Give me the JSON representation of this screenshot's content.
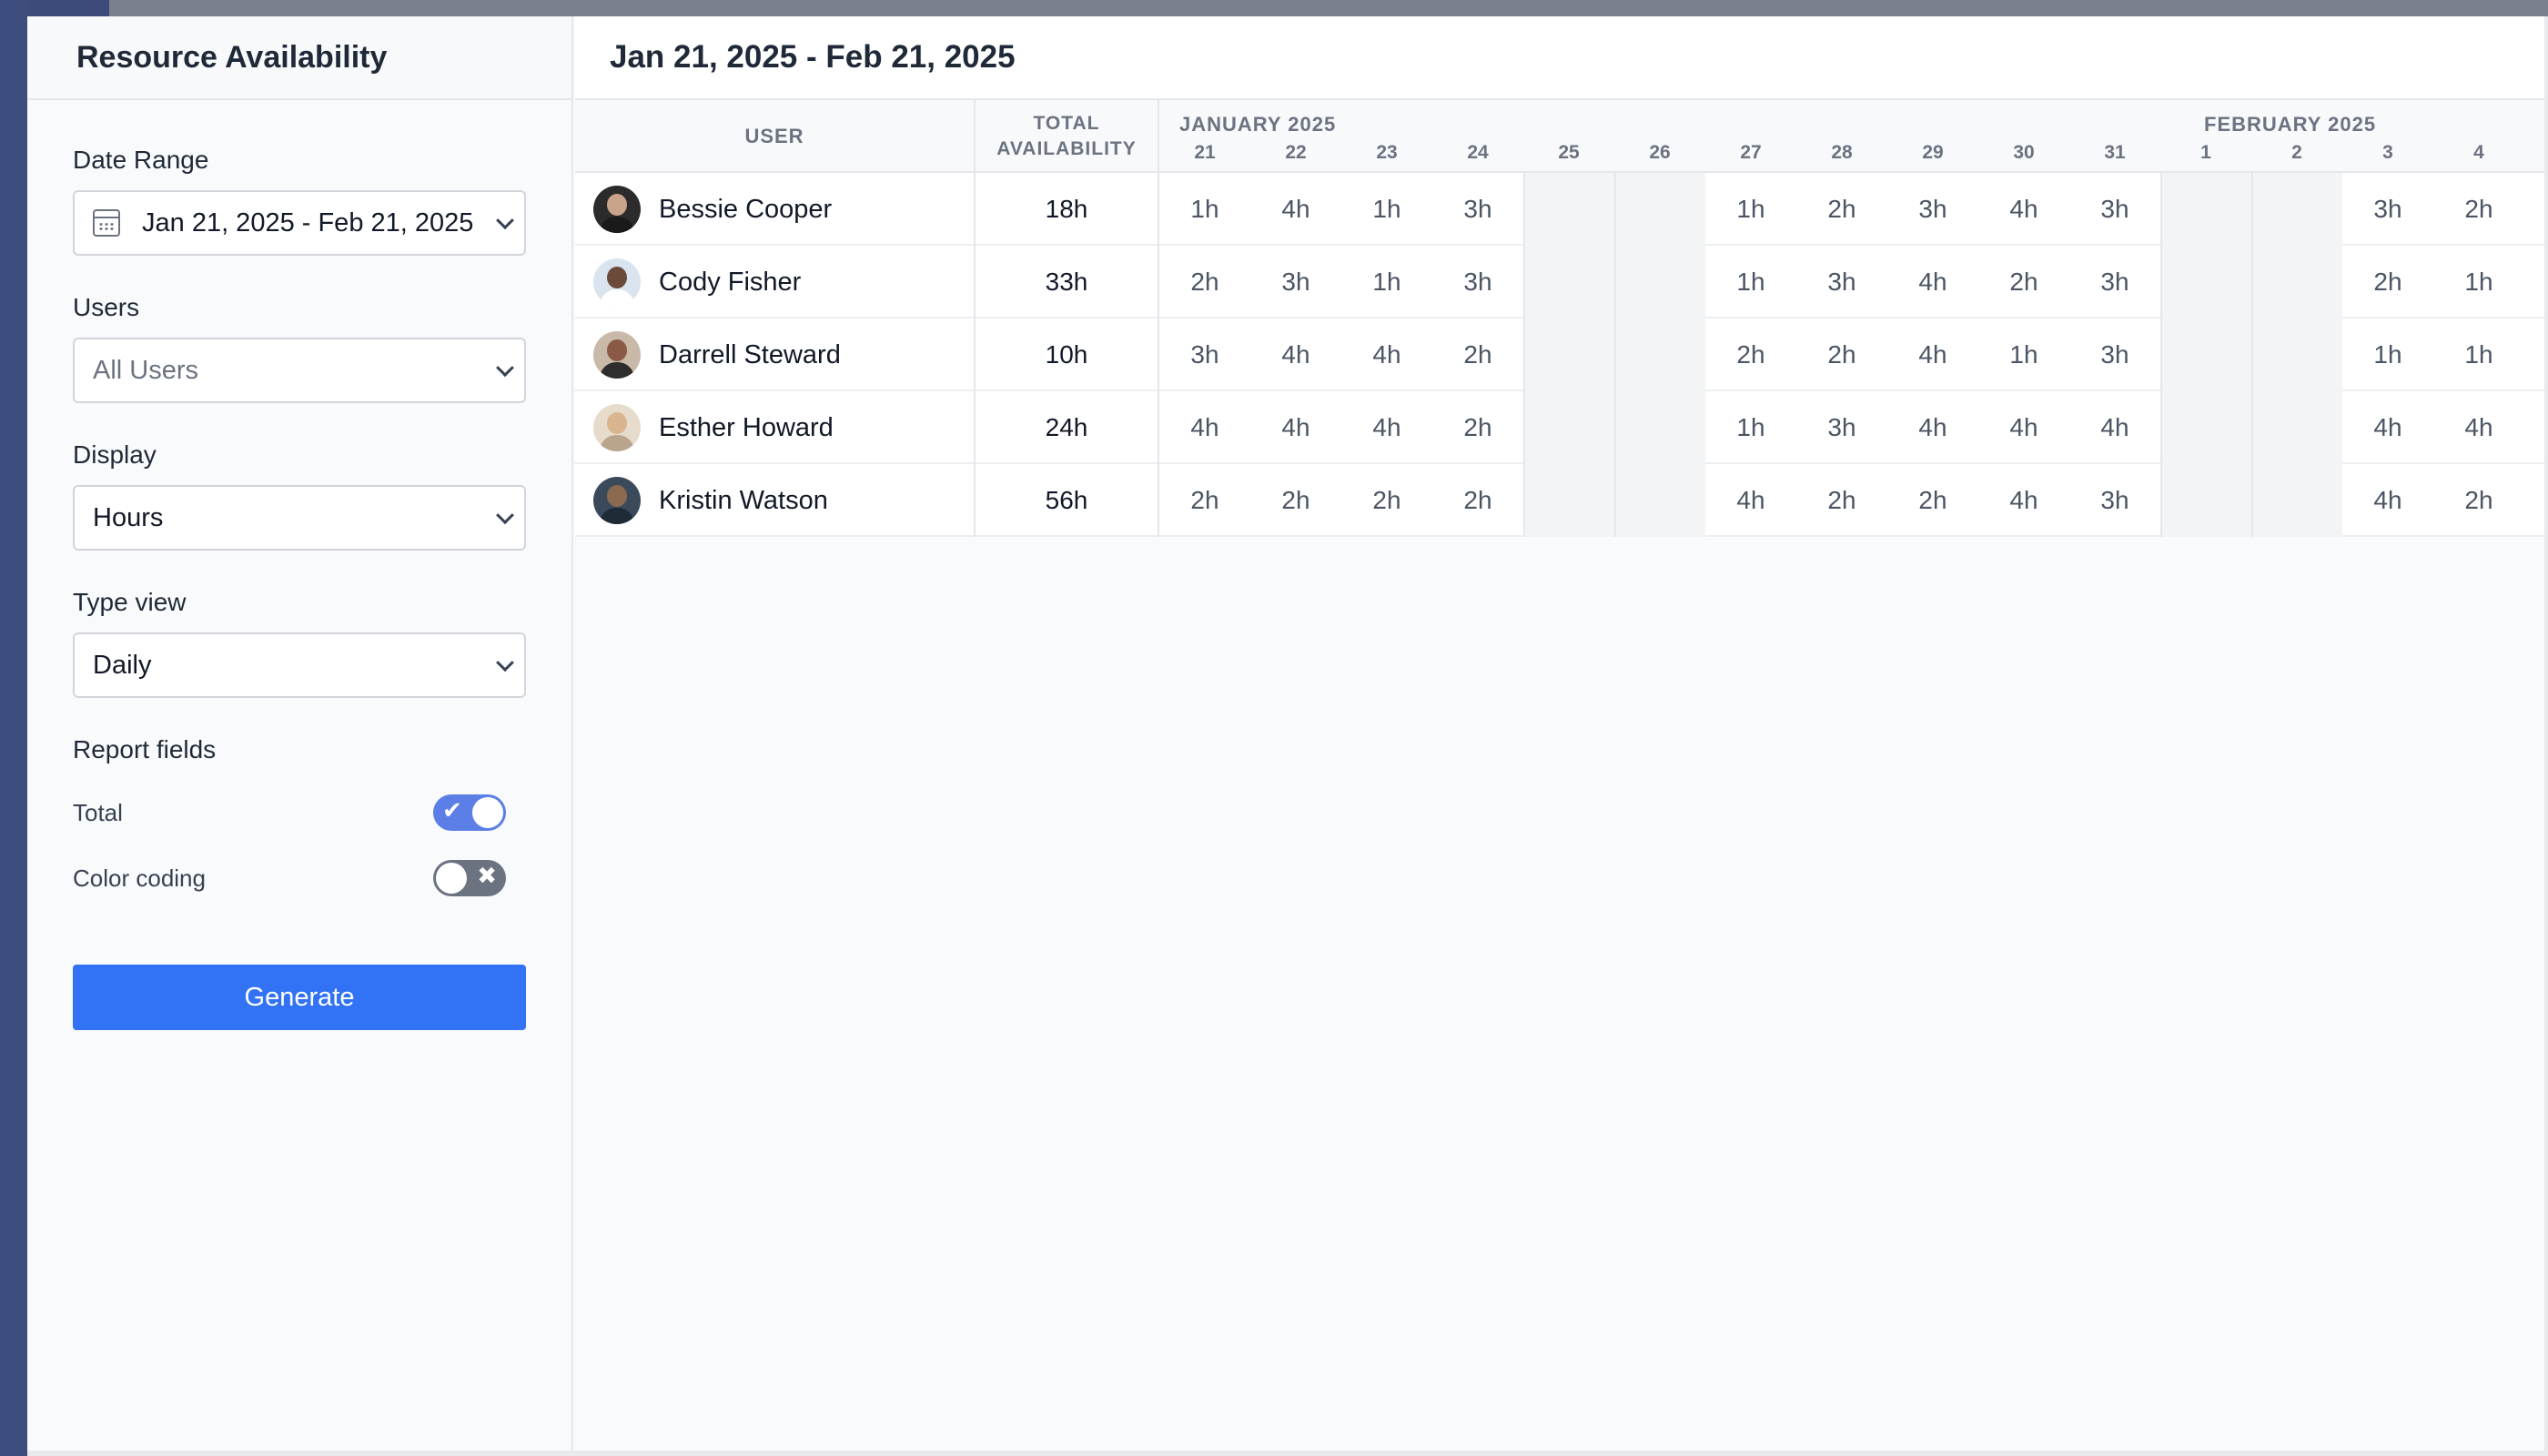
{
  "sidebar": {
    "title": "Resource Availability",
    "date_range": {
      "label": "Date Range",
      "value": "Jan 21, 2025 - Feb 21, 2025"
    },
    "users": {
      "label": "Users",
      "value": "All Users"
    },
    "display": {
      "label": "Display",
      "value": "Hours"
    },
    "type_view": {
      "label": "Type view",
      "value": "Daily"
    },
    "report_fields": {
      "label": "Report fields",
      "total": {
        "label": "Total",
        "on": true
      },
      "color_coding": {
        "label": "Color coding",
        "on": false
      }
    },
    "generate_label": "Generate"
  },
  "main": {
    "title": "Jan 21, 2025 - Feb 21, 2025",
    "columns": {
      "user": "USER",
      "total_line1": "TOTAL",
      "total_line2": "AVAILABILITY"
    },
    "months": [
      "JANUARY 2025",
      "FEBRUARY 2025"
    ],
    "days": [
      "21",
      "22",
      "23",
      "24",
      "25",
      "26",
      "27",
      "28",
      "29",
      "30",
      "31",
      "1",
      "2",
      "3",
      "4"
    ],
    "weekend_days": [
      "25",
      "26",
      "1",
      "2"
    ],
    "rows": [
      {
        "name": "Bessie Cooper",
        "total": "18h",
        "hours": [
          "1h",
          "4h",
          "1h",
          "3h",
          "",
          "",
          "1h",
          "2h",
          "3h",
          "4h",
          "3h",
          "",
          "",
          "3h",
          "2h"
        ]
      },
      {
        "name": "Cody Fisher",
        "total": "33h",
        "hours": [
          "2h",
          "3h",
          "1h",
          "3h",
          "",
          "",
          "1h",
          "3h",
          "4h",
          "2h",
          "3h",
          "",
          "",
          "2h",
          "1h"
        ]
      },
      {
        "name": "Darrell Steward",
        "total": "10h",
        "hours": [
          "3h",
          "4h",
          "4h",
          "2h",
          "",
          "",
          "2h",
          "2h",
          "4h",
          "1h",
          "3h",
          "",
          "",
          "1h",
          "1h"
        ]
      },
      {
        "name": "Esther Howard",
        "total": "24h",
        "hours": [
          "4h",
          "4h",
          "4h",
          "2h",
          "",
          "",
          "1h",
          "3h",
          "4h",
          "4h",
          "4h",
          "",
          "",
          "4h",
          "4h"
        ]
      },
      {
        "name": "Kristin Watson",
        "total": "56h",
        "hours": [
          "2h",
          "2h",
          "2h",
          "2h",
          "",
          "",
          "4h",
          "2h",
          "2h",
          "4h",
          "3h",
          "",
          "",
          "4h",
          "2h"
        ]
      }
    ]
  }
}
